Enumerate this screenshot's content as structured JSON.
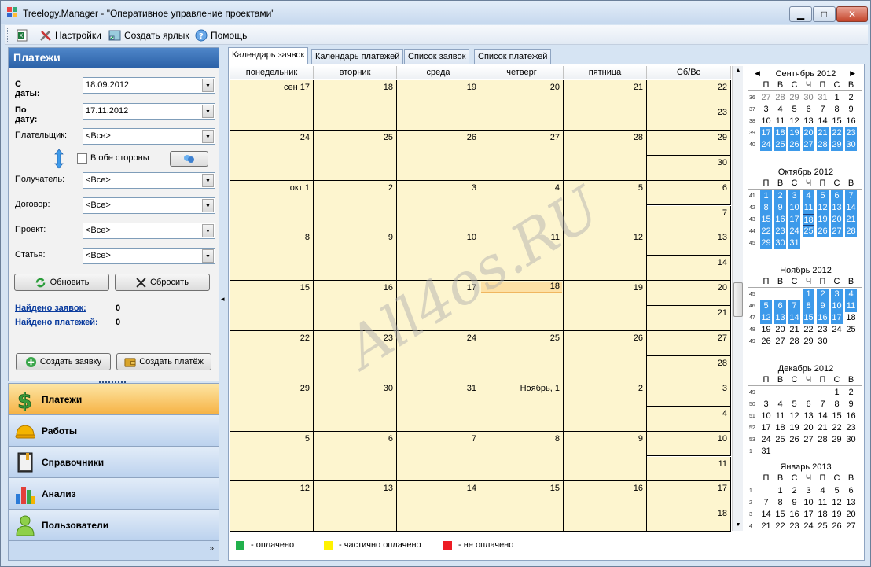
{
  "window": {
    "title": "Treelogy.Manager - \"Оперативное управление проектами\"",
    "min": "▁",
    "max": "□",
    "close": "✕"
  },
  "toolbar": {
    "settings": "Настройки",
    "shortcut": "Создать ярлык",
    "help": "Помощь"
  },
  "panel": {
    "title": "Платежи",
    "from_label": "С даты:",
    "from_value": "18.09.2012",
    "to_label": "По дату:",
    "to_value": "17.11.2012",
    "payer_label": "Плательщик:",
    "payer_value": "<Все>",
    "both_sides": "В обе стороны",
    "recipient_label": "Получатель:",
    "recipient_value": "<Все>",
    "contract_label": "Договор:",
    "contract_value": "<Все>",
    "project_label": "Проект:",
    "project_value": "<Все>",
    "article_label": "Статья:",
    "article_value": "<Все>",
    "refresh": "Обновить",
    "reset": "Сбросить",
    "found_requests_label": "Найдено заявок:",
    "found_requests": "0",
    "found_payments_label": "Найдено платежей:",
    "found_payments": "0",
    "create_request": "Создать заявку",
    "create_payment": "Создать платёж"
  },
  "nav": [
    {
      "label": "Платежи",
      "icon": "dollar-icon"
    },
    {
      "label": "Работы",
      "icon": "hardhat-icon"
    },
    {
      "label": "Справочники",
      "icon": "book-icon"
    },
    {
      "label": "Анализ",
      "icon": "bar-chart-icon"
    },
    {
      "label": "Пользователи",
      "icon": "user-icon"
    }
  ],
  "tabs": [
    "Календарь заявок",
    "Календарь платежей",
    "Список заявок",
    "Список платежей"
  ],
  "calendar": {
    "headers": [
      "понедельник",
      "вторник",
      "среда",
      "четверг",
      "пятница",
      "Сб/Вс"
    ],
    "weeks": [
      [
        "сен 17",
        "18",
        "19",
        "20",
        "21",
        "22",
        "23"
      ],
      [
        "24",
        "25",
        "26",
        "27",
        "28",
        "29",
        "30"
      ],
      [
        "окт 1",
        "2",
        "3",
        "4",
        "5",
        "6",
        "7"
      ],
      [
        "8",
        "9",
        "10",
        "11",
        "12",
        "13",
        "14"
      ],
      [
        "15",
        "16",
        "17",
        "18",
        "19",
        "20",
        "21"
      ],
      [
        "22",
        "23",
        "24",
        "25",
        "26",
        "27",
        "28"
      ],
      [
        "29",
        "30",
        "31",
        "Ноябрь, 1",
        "2",
        "3",
        "4"
      ],
      [
        "5",
        "6",
        "7",
        "8",
        "9",
        "10",
        "11"
      ],
      [
        "12",
        "13",
        "14",
        "15",
        "16",
        "17",
        "18"
      ]
    ]
  },
  "legend": [
    {
      "label": "- оплачено",
      "color": "#22b14c"
    },
    {
      "label": "- частично оплачено",
      "color": "#fff200"
    },
    {
      "label": "- не оплачено",
      "color": "#ed1c24"
    }
  ],
  "watermark": "All4os.RU",
  "mini": {
    "dow": [
      "П",
      "В",
      "С",
      "Ч",
      "П",
      "С",
      "В"
    ],
    "months": [
      {
        "title": "Сентябрь 2012",
        "rows": [
          {
            "wk": "36",
            "days": [
              "27",
              "28",
              "29",
              "30",
              "31",
              "1",
              "2"
            ]
          },
          {
            "wk": "37",
            "days": [
              "3",
              "4",
              "5",
              "6",
              "7",
              "8",
              "9"
            ]
          },
          {
            "wk": "38",
            "days": [
              "10",
              "11",
              "12",
              "13",
              "14",
              "15",
              "16"
            ]
          },
          {
            "wk": "39",
            "days": [
              "17",
              "18",
              "19",
              "20",
              "21",
              "22",
              "23"
            ]
          },
          {
            "wk": "40",
            "days": [
              "24",
              "25",
              "26",
              "27",
              "28",
              "29",
              "30"
            ]
          }
        ]
      },
      {
        "title": "Октябрь 2012",
        "rows": [
          {
            "wk": "41",
            "days": [
              "1",
              "2",
              "3",
              "4",
              "5",
              "6",
              "7"
            ]
          },
          {
            "wk": "42",
            "days": [
              "8",
              "9",
              "10",
              "11",
              "12",
              "13",
              "14"
            ]
          },
          {
            "wk": "43",
            "days": [
              "15",
              "16",
              "17",
              "18",
              "19",
              "20",
              "21"
            ]
          },
          {
            "wk": "44",
            "days": [
              "22",
              "23",
              "24",
              "25",
              "26",
              "27",
              "28"
            ]
          },
          {
            "wk": "45",
            "days": [
              "29",
              "30",
              "31",
              "",
              "",
              "",
              ""
            ]
          }
        ]
      },
      {
        "title": "Ноябрь 2012",
        "rows": [
          {
            "wk": "45",
            "days": [
              "",
              "",
              "",
              "1",
              "2",
              "3",
              "4"
            ]
          },
          {
            "wk": "46",
            "days": [
              "5",
              "6",
              "7",
              "8",
              "9",
              "10",
              "11"
            ]
          },
          {
            "wk": "47",
            "days": [
              "12",
              "13",
              "14",
              "15",
              "16",
              "17",
              "18"
            ]
          },
          {
            "wk": "48",
            "days": [
              "19",
              "20",
              "21",
              "22",
              "23",
              "24",
              "25"
            ]
          },
          {
            "wk": "49",
            "days": [
              "26",
              "27",
              "28",
              "29",
              "30",
              "",
              ""
            ]
          }
        ]
      },
      {
        "title": "Декабрь 2012",
        "rows": [
          {
            "wk": "49",
            "days": [
              "",
              "",
              "",
              "",
              "",
              "1",
              "2"
            ]
          },
          {
            "wk": "50",
            "days": [
              "3",
              "4",
              "5",
              "6",
              "7",
              "8",
              "9"
            ]
          },
          {
            "wk": "51",
            "days": [
              "10",
              "11",
              "12",
              "13",
              "14",
              "15",
              "16"
            ]
          },
          {
            "wk": "52",
            "days": [
              "17",
              "18",
              "19",
              "20",
              "21",
              "22",
              "23"
            ]
          },
          {
            "wk": "53",
            "days": [
              "24",
              "25",
              "26",
              "27",
              "28",
              "29",
              "30"
            ]
          },
          {
            "wk": "1",
            "days": [
              "31",
              "",
              "",
              "",
              "",
              "",
              ""
            ]
          }
        ]
      },
      {
        "title": "Январь 2013",
        "rows": [
          {
            "wk": "1",
            "days": [
              "",
              "1",
              "2",
              "3",
              "4",
              "5",
              "6"
            ]
          },
          {
            "wk": "2",
            "days": [
              "7",
              "8",
              "9",
              "10",
              "11",
              "12",
              "13"
            ]
          },
          {
            "wk": "3",
            "days": [
              "14",
              "15",
              "16",
              "17",
              "18",
              "19",
              "20"
            ]
          },
          {
            "wk": "4",
            "days": [
              "21",
              "22",
              "23",
              "24",
              "25",
              "26",
              "27"
            ]
          }
        ]
      }
    ]
  }
}
